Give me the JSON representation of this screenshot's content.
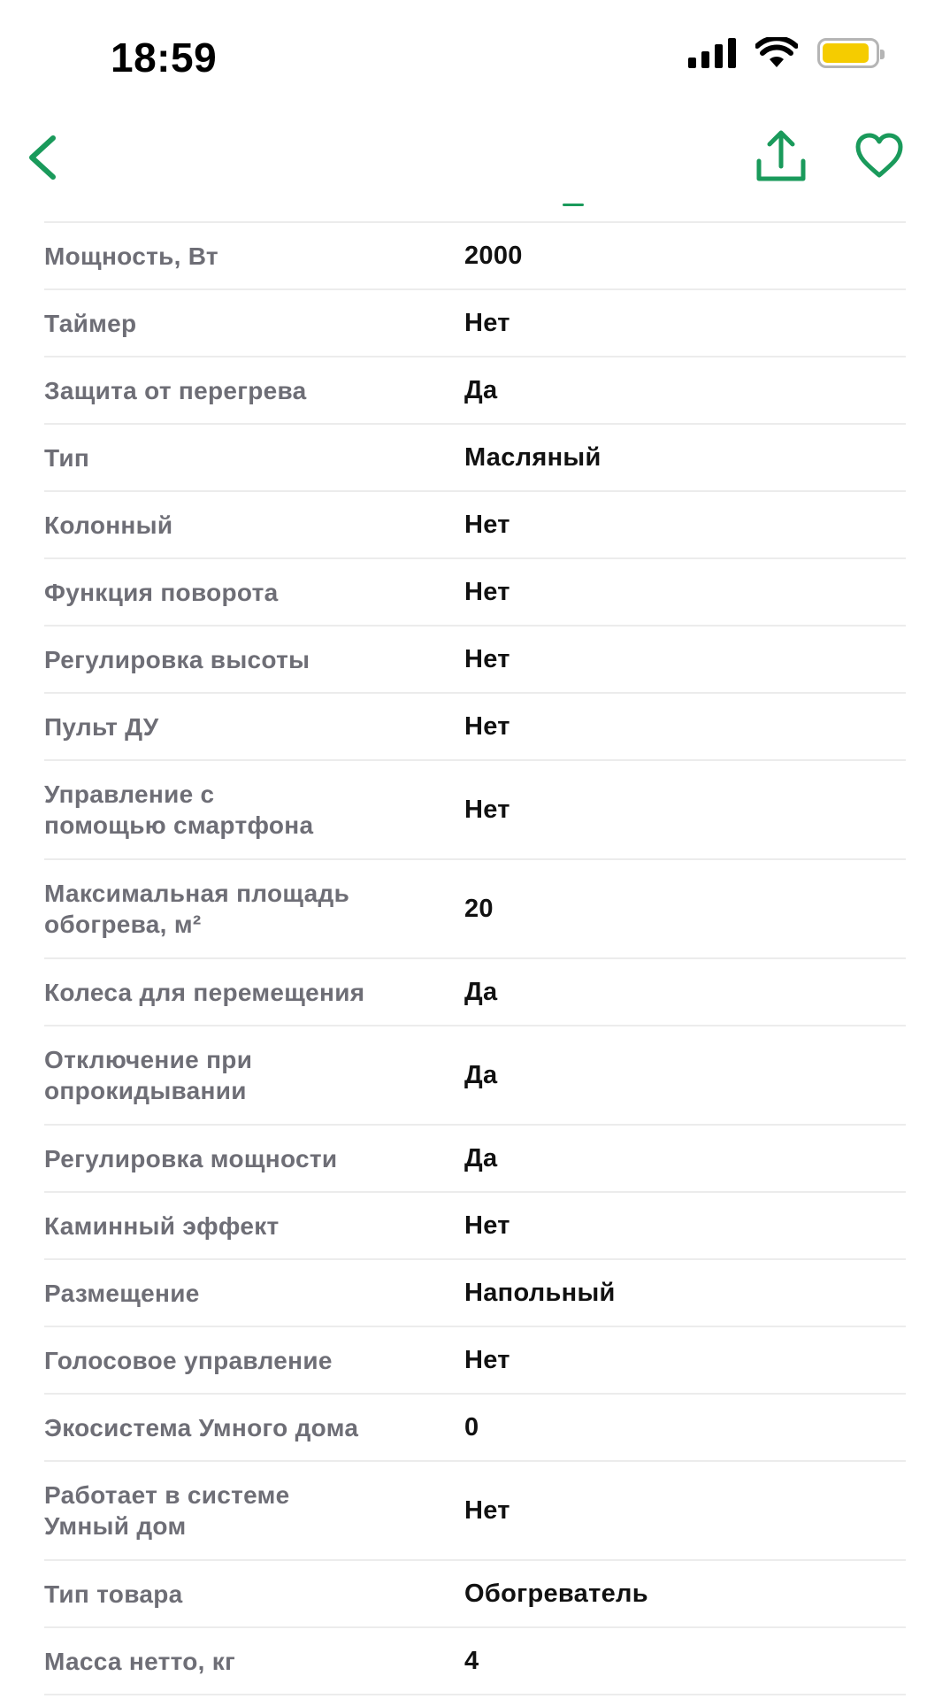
{
  "status_bar": {
    "time": "18:59",
    "icons": [
      "cellular-signal-icon",
      "wifi-icon",
      "battery-icon"
    ],
    "battery_color": "#f5cc00",
    "battery_level": 0.9
  },
  "nav": {
    "icons": [
      "chevron-left-icon",
      "share-icon",
      "heart-icon"
    ],
    "accent_color": "#1a9a5b"
  },
  "specs": [
    {
      "label": "Мощность, Вт",
      "value": "2000"
    },
    {
      "label": "Таймер",
      "value": "Нет"
    },
    {
      "label": "Защита от перегрева",
      "value": "Да"
    },
    {
      "label": "Тип",
      "value": "Масляный"
    },
    {
      "label": "Колонный",
      "value": "Нет"
    },
    {
      "label": "Функция поворота",
      "value": "Нет"
    },
    {
      "label": "Регулировка высоты",
      "value": "Нет"
    },
    {
      "label": "Пульт ДУ",
      "value": "Нет"
    },
    {
      "label": "Управление с\nпомощью смартфона",
      "value": "Нет"
    },
    {
      "label": "Максимальная площадь\nобогрева, м²",
      "value": "20"
    },
    {
      "label": "Колеса для перемещения",
      "value": "Да"
    },
    {
      "label": "Отключение при\nопрокидывании",
      "value": "Да"
    },
    {
      "label": "Регулировка мощности",
      "value": "Да"
    },
    {
      "label": "Каминный эффект",
      "value": "Нет"
    },
    {
      "label": "Размещение",
      "value": "Напольный"
    },
    {
      "label": "Голосовое управление",
      "value": "Нет"
    },
    {
      "label": "Экосистема Умного дома",
      "value": "0"
    },
    {
      "label": "Работает в системе\nУмный дом",
      "value": "Нет"
    },
    {
      "label": "Тип товара",
      "value": "Обогреватель"
    },
    {
      "label": "Масса нетто, кг",
      "value": "4"
    }
  ]
}
